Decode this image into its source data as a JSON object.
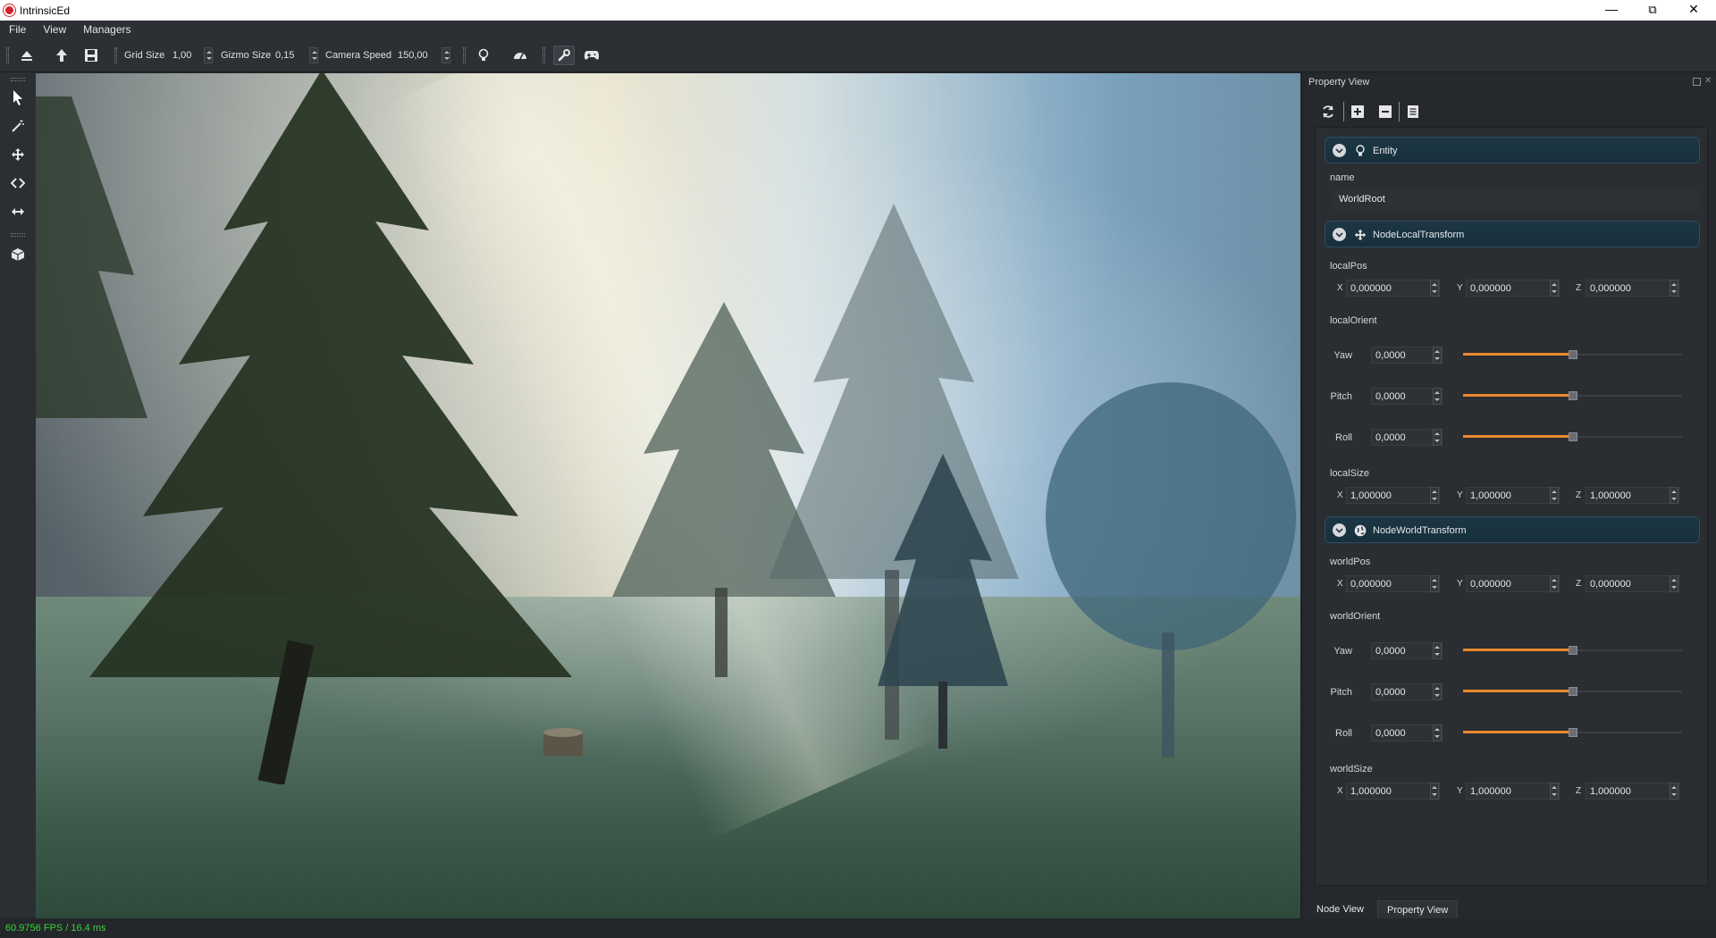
{
  "window": {
    "title": "IntrinsicEd",
    "minimize": "—",
    "maximize": "⧉",
    "close": "✕"
  },
  "menu": {
    "items": [
      "File",
      "View",
      "Managers"
    ]
  },
  "toolbar": {
    "grid_size": {
      "label": "Grid Size",
      "value": "1,00"
    },
    "gizmo_size": {
      "label": "Gizmo Size",
      "value": "0,15"
    },
    "camera_speed": {
      "label": "Camera Speed",
      "value": "150,00"
    },
    "active_tool": "wrench"
  },
  "left_tools": {
    "selected": "select"
  },
  "property_view": {
    "title": "Property View",
    "entity": {
      "header": "Entity",
      "name_label": "name",
      "name_value": "WorldRoot"
    },
    "local_transform": {
      "header": "NodeLocalTransform",
      "pos_label": "localPos",
      "pos": {
        "x": "0,000000",
        "y": "0,000000",
        "z": "0,000000"
      },
      "orient_label": "localOrient",
      "orient": [
        {
          "label": "Yaw",
          "value": "0,0000",
          "level": 0.5
        },
        {
          "label": "Pitch",
          "value": "0,0000",
          "level": 0.5
        },
        {
          "label": "Roll",
          "value": "0,0000",
          "level": 0.5
        }
      ],
      "size_label": "localSize",
      "size": {
        "x": "1,000000",
        "y": "1,000000",
        "z": "1,000000"
      }
    },
    "world_transform": {
      "header": "NodeWorldTransform",
      "pos_label": "worldPos",
      "pos": {
        "x": "0,000000",
        "y": "0,000000",
        "z": "0,000000"
      },
      "orient_label": "worldOrient",
      "orient": [
        {
          "label": "Yaw",
          "value": "0,0000",
          "level": 0.5
        },
        {
          "label": "Pitch",
          "value": "0,0000",
          "level": 0.5
        },
        {
          "label": "Roll",
          "value": "0,0000",
          "level": 0.5
        }
      ],
      "size_label": "worldSize",
      "size": {
        "x": "1,000000",
        "y": "1,000000",
        "z": "1,000000"
      }
    },
    "axis": {
      "x": "X",
      "y": "Y",
      "z": "Z"
    }
  },
  "tabs": {
    "node_view": "Node View",
    "property_view": "Property View"
  },
  "status": {
    "fps": "60.9756 FPS / 16.4 ms"
  },
  "colors": {
    "accent": "#e8892c",
    "fps": "#3ad63a",
    "section_header": "#1d3644"
  }
}
